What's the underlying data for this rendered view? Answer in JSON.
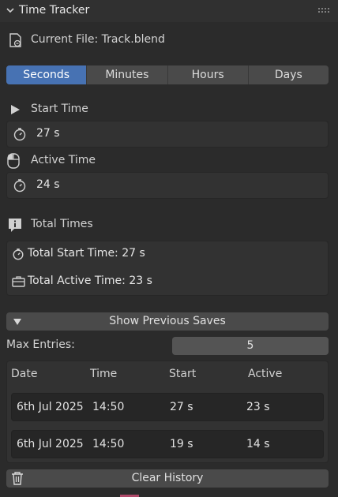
{
  "panel": {
    "title": "Time Tracker"
  },
  "current_file": {
    "label": "Current File: Track.blend"
  },
  "units": {
    "tabs": [
      "Seconds",
      "Minutes",
      "Hours",
      "Days"
    ],
    "selected": "Seconds"
  },
  "start_time": {
    "label": "Start Time",
    "value": "27 s"
  },
  "active_time": {
    "label": "Active Time",
    "value": "24 s"
  },
  "total_times": {
    "label": "Total Times",
    "total_start": "Total Start Time: 27 s",
    "total_active": "Total Active Time: 23 s"
  },
  "previous_saves": {
    "toggle_label": "Show Previous Saves"
  },
  "max_entries": {
    "label": "Max Entries:",
    "value": "5"
  },
  "history": {
    "columns": [
      "Date",
      "Time",
      "Start",
      "Active"
    ],
    "rows": [
      [
        "6th Jul 2025",
        "14:50",
        "27 s",
        "23 s"
      ],
      [
        "6th Jul 2025",
        "14:50",
        "19 s",
        "14 s"
      ]
    ]
  },
  "clear_history": {
    "label": "Clear History"
  },
  "colors": {
    "accent": "#4772b3",
    "background": "#2b2b2b"
  },
  "icons": [
    "chevron-down-icon",
    "drag-handle-icon",
    "file-icon",
    "play-icon",
    "mouse-icon",
    "stopwatch-icon",
    "info-icon",
    "briefcase-icon",
    "triangle-down-icon",
    "trash-icon"
  ]
}
